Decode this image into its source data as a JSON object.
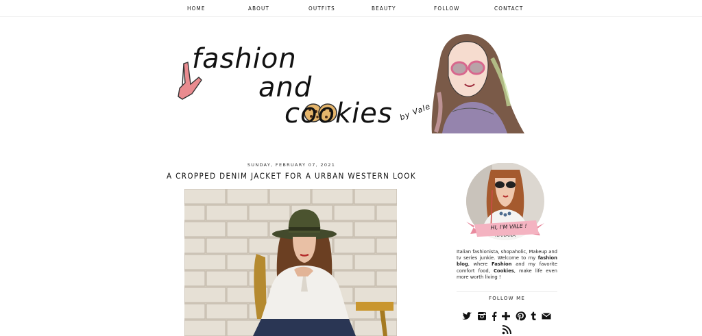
{
  "nav": {
    "items": [
      "HOME",
      "ABOUT",
      "OUTFITS",
      "BEAUTY",
      "FOLLOW",
      "CONTACT"
    ]
  },
  "header": {
    "logo_line1": "fashion",
    "logo_line2": "and",
    "logo_line3": "cookies",
    "logo_byline": "by Vale"
  },
  "post": {
    "date": "SUNDAY, FEBRUARY 07, 2021",
    "title": "A CROPPED DENIM JACKET FOR A URBAN WESTERN LOOK"
  },
  "sidebar": {
    "avatar_banner": "HI, I'M VALE !",
    "about_p1": "Italian fashionista, shopaholic, Makeup and tv series junkie. Welcome to my ",
    "about_b1": "fashion blog",
    "about_p2": ", where ",
    "about_b2": "Fashion",
    "about_p3": " and my favorite comfort food, ",
    "about_b3": "Cookies",
    "about_p4": ", make life even more worth living !",
    "follow_title": "FOLLOW ME",
    "social_icons": [
      "twitter-icon",
      "instagram-icon",
      "facebook-icon",
      "google-plus-icon",
      "pinterest-icon",
      "tumblr-icon",
      "email-icon",
      "rss-icon"
    ]
  },
  "colors": {
    "accent_pink": "#f0a5b5",
    "text": "#111111",
    "divider": "#e8e8e8"
  }
}
